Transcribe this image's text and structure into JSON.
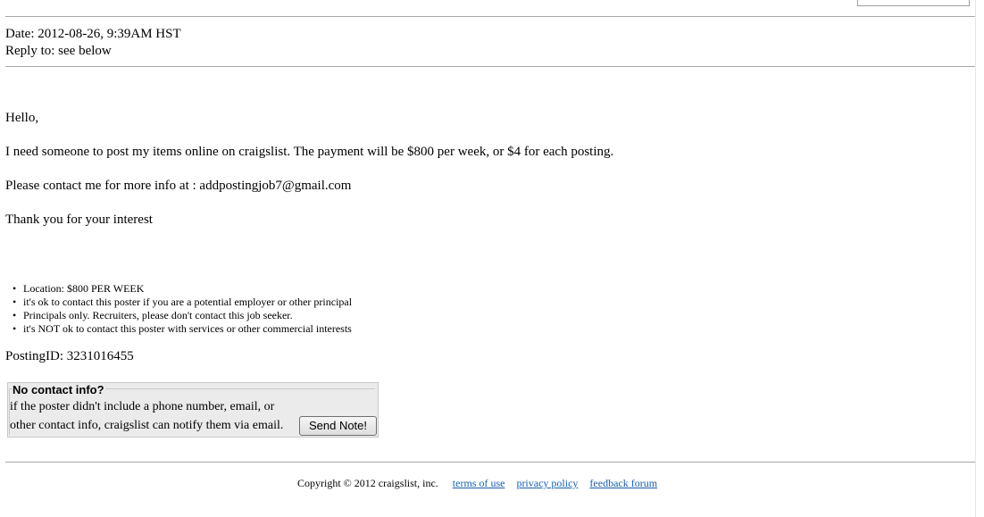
{
  "header": {
    "date_line": "Date: 2012-08-26, 9:39AM HST",
    "reply_line": "Reply to: see below"
  },
  "body": {
    "greeting": "Hello,",
    "paragraph1": "I need someone to post my items online on craigslist. The payment will be $800 per week, or $4 for each posting.",
    "paragraph2": "Please contact me for more info at : addpostingjob7@gmail.com",
    "paragraph3": "Thank you for your interest"
  },
  "bullets": [
    "Location: $800 PER WEEK",
    "it's ok to contact this poster if you are a potential employer or other principal",
    "Principals only. Recruiters, please don't contact this job seeker.",
    "it's NOT ok to contact this poster with services or other commercial interests"
  ],
  "posting_id": "PostingID: 3231016455",
  "notify": {
    "legend": "No contact info?",
    "line1": "if the poster didn't include a phone number, email, or",
    "line2": "other contact info, craigslist can notify them via email.",
    "button_label": "Send Note!"
  },
  "footer": {
    "copyright": "Copyright © 2012 craigslist, inc.",
    "links": [
      "terms of use",
      "privacy policy",
      "feedback forum"
    ]
  },
  "colors": {
    "link": "#1a5fa8",
    "rule": "#a8a8a8",
    "notify_bg": "#ebebeb"
  }
}
